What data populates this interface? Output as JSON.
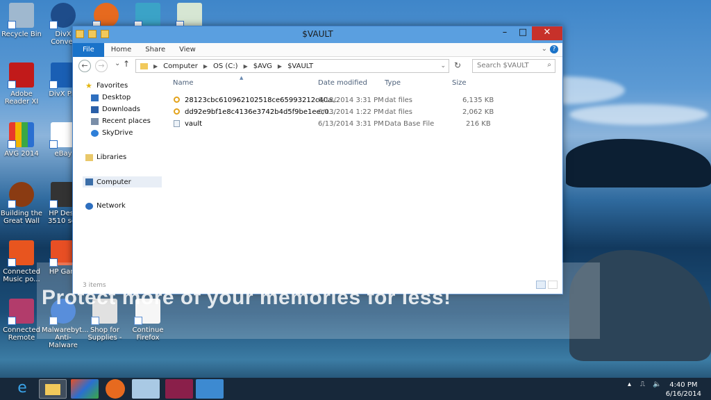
{
  "desktop": {
    "icons": [
      {
        "label": "Recycle Bin",
        "icon": "recycle-bin-icon"
      },
      {
        "label": "DivX Conver",
        "icon": "divx-converter-icon"
      },
      {
        "label": "Adobe Reader XI",
        "icon": "adobe-reader-icon"
      },
      {
        "label": "DivX Pla",
        "icon": "divx-player-icon"
      },
      {
        "label": "AVG 2014",
        "icon": "avg-icon"
      },
      {
        "label": "eBay",
        "icon": "ebay-icon"
      },
      {
        "label": "Building the Great Wall",
        "icon": "game-icon"
      },
      {
        "label": "HP Desk 3510 ser",
        "icon": "printer-icon"
      },
      {
        "label": "Connected Music po...",
        "icon": "music-icon"
      },
      {
        "label": "HP Gam",
        "icon": "hp-games-icon"
      },
      {
        "label": "Connected Remote",
        "icon": "remote-icon"
      },
      {
        "label": "Malwarebyt... Anti-Malware",
        "icon": "malwarebytes-icon"
      },
      {
        "label": "Shop for Supplies -",
        "icon": "shop-icon"
      },
      {
        "label": "Continue Firefox",
        "icon": "firefox-icon"
      }
    ],
    "watermark": "Protect more of your memories for less!"
  },
  "window": {
    "title": "$VAULT",
    "ribbon_tabs": [
      "File",
      "Home",
      "Share",
      "View"
    ],
    "address": [
      "Computer",
      "OS (C:)",
      "$AVG",
      "$VAULT"
    ],
    "search_placeholder": "Search $VAULT",
    "nav": {
      "favorites": "Favorites",
      "desktop": "Desktop",
      "downloads": "Downloads",
      "recent": "Recent places",
      "skydrive": "SkyDrive",
      "libraries": "Libraries",
      "computer": "Computer",
      "network": "Network"
    },
    "columns": {
      "name": "Name",
      "date": "Date modified",
      "type": "Type",
      "size": "Size"
    },
    "files": [
      {
        "name": "28123cbc610962102518ce65993212c40a...",
        "date": "6/13/2014 3:31 PM",
        "type": "dat files",
        "size": "6,135 KB"
      },
      {
        "name": "dd92e9bf1e8c4136e3742b4d5f9be1eec0...",
        "date": "6/13/2014 1:22 PM",
        "type": "dat files",
        "size": "2,062 KB"
      },
      {
        "name": "vault",
        "date": "6/13/2014 3:31 PM",
        "type": "Data Base File",
        "size": "216 KB"
      }
    ],
    "status": "3 items"
  },
  "taskbar": {
    "time": "4:40 PM",
    "date": "6/16/2014",
    "apps": [
      "internet-explorer-icon",
      "file-explorer-icon",
      "app-icon",
      "firefox-icon",
      "notepad-icon",
      "text-app-icon",
      "network-app-icon"
    ]
  },
  "colors": {
    "accent": "#1a73c9",
    "title_bar": "#5a9fe0",
    "close": "#c7312a"
  }
}
